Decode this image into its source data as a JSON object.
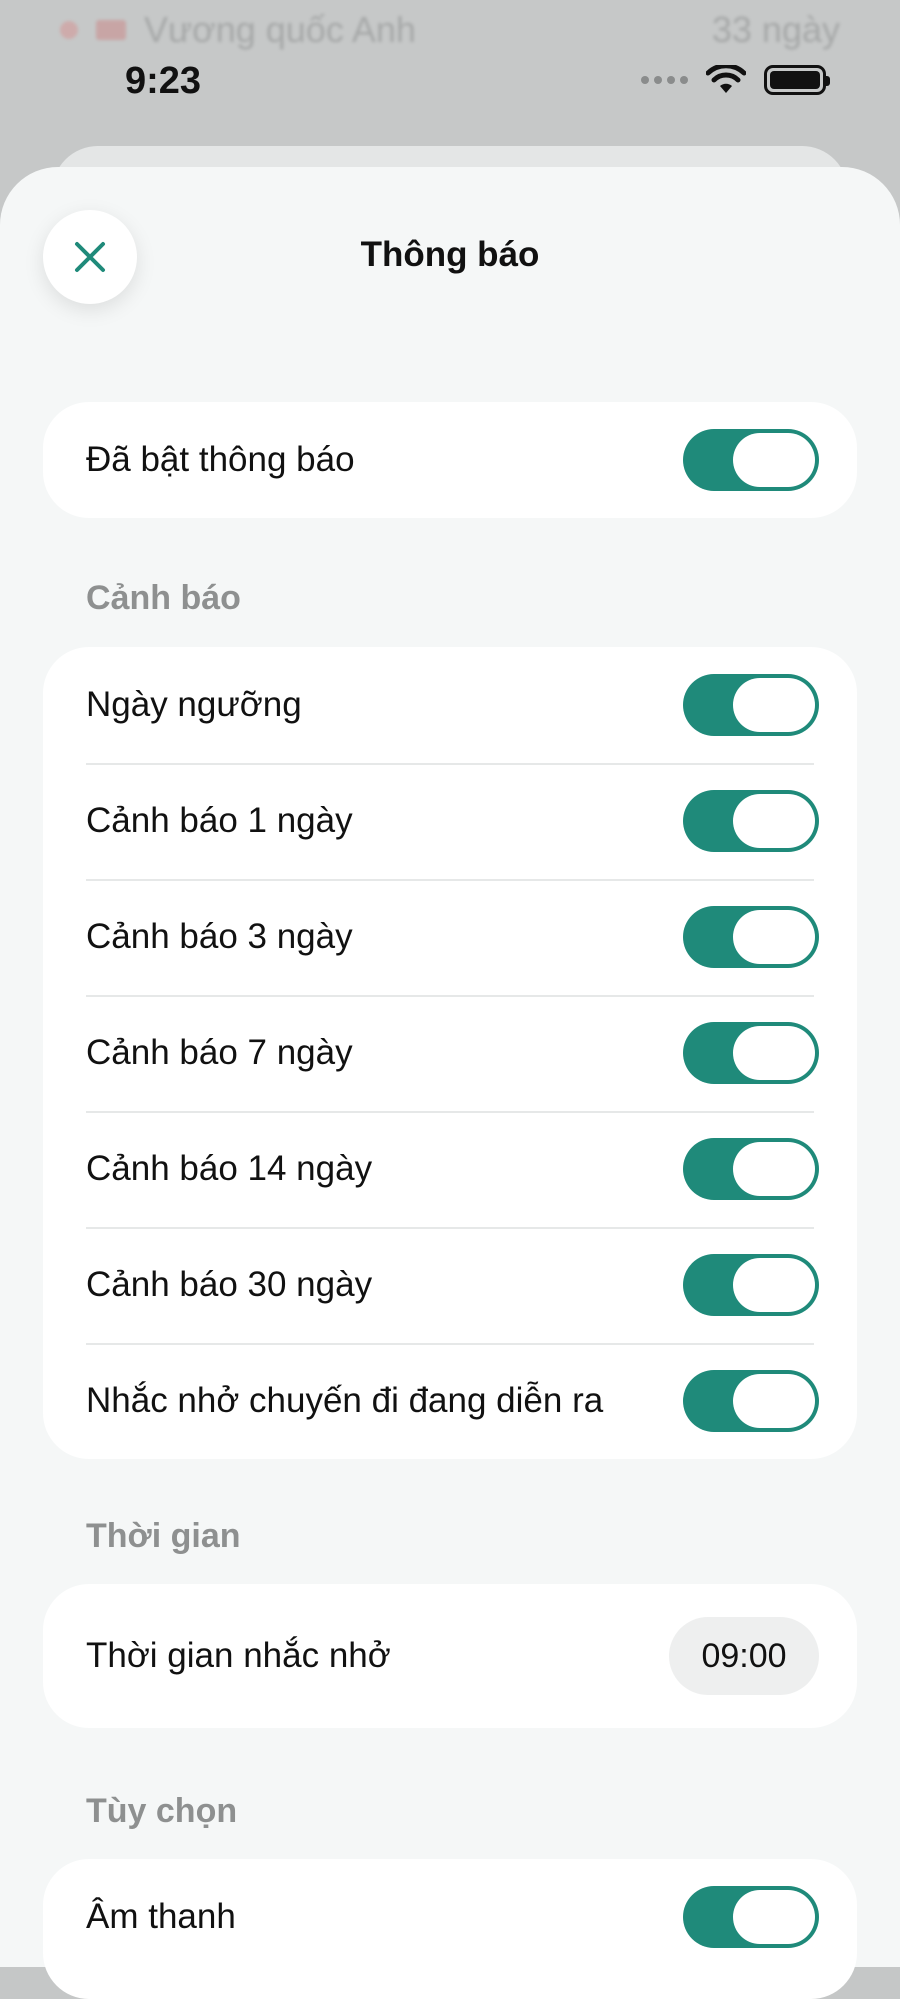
{
  "background": {
    "row_text": "Vương quốc Anh",
    "row_right": "33 ngày"
  },
  "status_bar": {
    "time": "9:23"
  },
  "sheet": {
    "title": "Thông báo",
    "close_icon": "close-icon"
  },
  "master": {
    "label": "Đã bật thông báo",
    "enabled": true
  },
  "alerts": {
    "section_title": "Cảnh báo",
    "items": [
      {
        "label": "Ngày ngưỡng",
        "enabled": true
      },
      {
        "label": "Cảnh báo 1 ngày",
        "enabled": true
      },
      {
        "label": "Cảnh báo 3 ngày",
        "enabled": true
      },
      {
        "label": "Cảnh báo 7 ngày",
        "enabled": true
      },
      {
        "label": "Cảnh báo 14 ngày",
        "enabled": true
      },
      {
        "label": "Cảnh báo 30 ngày",
        "enabled": true
      },
      {
        "label": "Nhắc nhở chuyến đi đang diễn ra",
        "enabled": true
      }
    ]
  },
  "time": {
    "section_title": "Thời gian",
    "reminder_label": "Thời gian nhắc nhở",
    "reminder_value": "09:00"
  },
  "options": {
    "section_title": "Tùy chọn",
    "sound_label": "Âm thanh",
    "sound_enabled": true
  },
  "colors": {
    "accent": "#1f8a7a",
    "sheet_bg": "#f5f7f7",
    "card_bg": "#ffffff",
    "section_title": "#8e9090"
  }
}
